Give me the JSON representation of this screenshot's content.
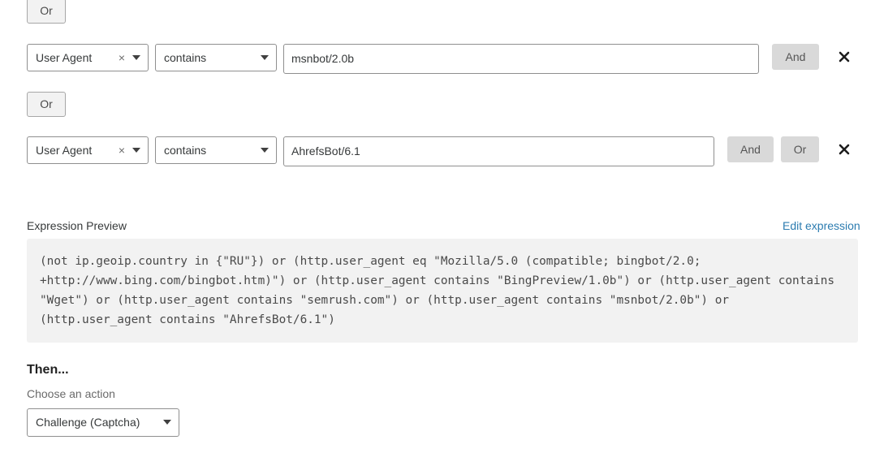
{
  "conditions": [
    {
      "field": "User Agent",
      "operator": "contains",
      "value": "msnbot/2.0b",
      "and_label": "And"
    },
    {
      "field": "User Agent",
      "operator": "contains",
      "value": "AhrefsBot/6.1",
      "and_label": "And",
      "or_label": "Or"
    }
  ],
  "or_separator_top": "Or",
  "or_separator_mid": "Or",
  "clear_glyph": "×",
  "expression": {
    "title": "Expression Preview",
    "edit_link": "Edit expression",
    "text": "(not ip.geoip.country in {\"RU\"}) or (http.user_agent eq \"Mozilla/5.0 (compatible; bingbot/2.0; +http://www.bing.com/bingbot.htm)\") or (http.user_agent contains \"BingPreview/1.0b\") or (http.user_agent contains \"Wget\") or (http.user_agent contains \"semrush.com\") or (http.user_agent contains \"msnbot/2.0b\") or (http.user_agent contains \"AhrefsBot/6.1\")"
  },
  "then": {
    "heading": "Then...",
    "subheading": "Choose an action",
    "action": "Challenge (Captcha)"
  },
  "icons": {
    "close": "close-icon",
    "caret": "chevron-down-icon"
  }
}
